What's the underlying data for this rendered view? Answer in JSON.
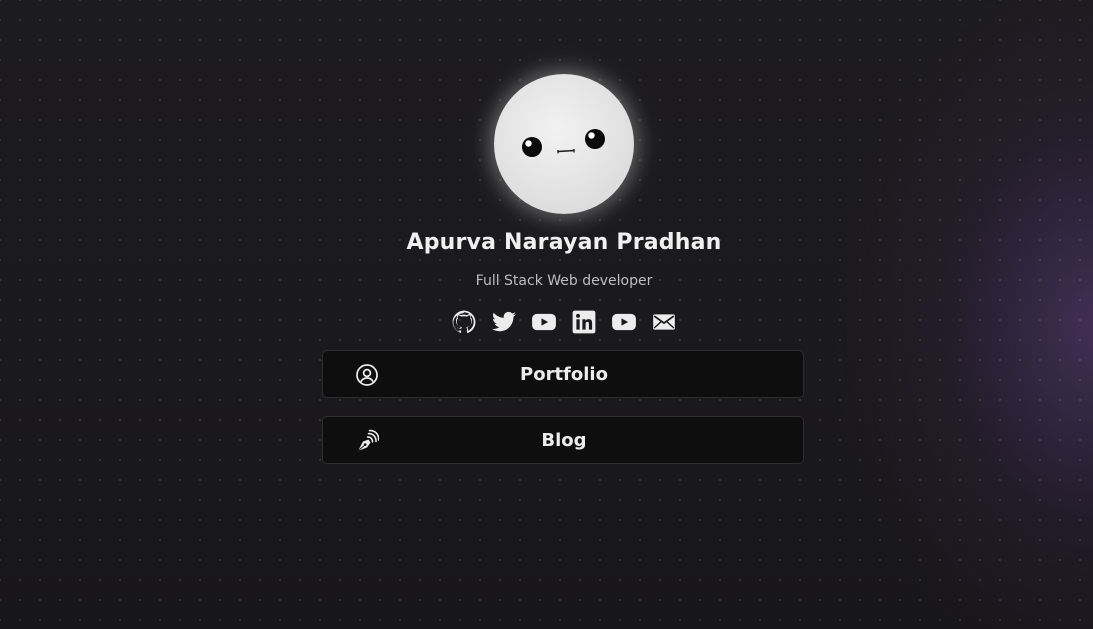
{
  "profile": {
    "name": "Apurva Narayan Pradhan",
    "tagline": "Full Stack Web developer"
  },
  "socials": [
    {
      "icon": "github-icon"
    },
    {
      "icon": "twitter-icon"
    },
    {
      "icon": "youtube-icon"
    },
    {
      "icon": "linkedin-icon"
    },
    {
      "icon": "youtube-icon"
    },
    {
      "icon": "mail-icon"
    }
  ],
  "links": [
    {
      "label": "Portfolio",
      "icon": "user-circle-icon"
    },
    {
      "label": "Blog",
      "icon": "pen-nib-icon"
    }
  ],
  "colors": {
    "background": "#19181a",
    "accent_glow": "#604082",
    "button_bg": "#0e0e0f",
    "text": "#ececec"
  }
}
